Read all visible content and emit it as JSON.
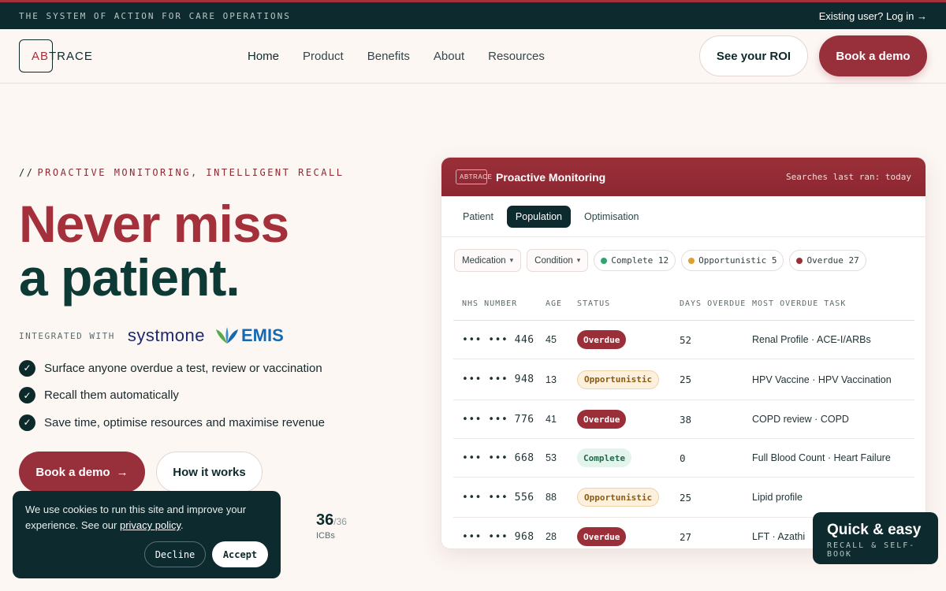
{
  "topbar": {
    "tagline": "THE SYSTEM OF ACTION FOR CARE OPERATIONS",
    "login": "Existing user? Log in →"
  },
  "brand": {
    "logo_ab": "AB",
    "logo_rest": "TRACE"
  },
  "nav": {
    "links": [
      "Home",
      "Product",
      "Benefits",
      "About",
      "Resources"
    ],
    "roi_label": "See your ROI",
    "demo_label": "Book a demo"
  },
  "hero": {
    "eyebrow_prefix": "//",
    "eyebrow": "PROACTIVE MONITORING, INTELLIGENT RECALL",
    "headline_line1": "Never miss",
    "headline_line2": "a patient.",
    "integrated_label": "INTEGRATED WITH",
    "partner1": "systmone",
    "partner2": "EMIS",
    "checks": [
      "Surface anyone overdue a test, review or vaccination",
      "Recall them automatically",
      "Save time, optimise resources and maximise revenue"
    ],
    "cta_primary": "Book a demo",
    "cta_secondary": "How it works",
    "stat_value": "36",
    "stat_total": "/36",
    "stat_label": "ICBs"
  },
  "cookie": {
    "message": "We use cookies to run this site and improve your experience. See our",
    "link": "privacy policy",
    "decline": "Decline",
    "accept": "Accept"
  },
  "panel": {
    "mini_logo": "ABTRACE",
    "title": "Proactive Monitoring",
    "meta": "Searches last ran: today",
    "tabs": [
      "Patient",
      "Population",
      "Optimisation"
    ],
    "active_tab": "Population",
    "filter_medication": "Medication",
    "filter_condition": "Condition",
    "pills": [
      {
        "label": "Complete 12",
        "color": "#2fa56e"
      },
      {
        "label": "Opportunistic 5",
        "color": "#e0a030"
      },
      {
        "label": "Overdue 27",
        "color": "#9a2f39"
      }
    ],
    "columns": [
      "NHS NUMBER",
      "AGE",
      "STATUS",
      "DAYS OVERDUE",
      "MOST OVERDUE TASK"
    ],
    "rows": [
      {
        "nhs": "••• ••• 446",
        "age": "45",
        "status": "Overdue",
        "days": "52",
        "task": "Renal Profile · ACE-I/ARBs"
      },
      {
        "nhs": "••• ••• 948",
        "age": "13",
        "status": "Opportunistic",
        "days": "25",
        "task": "HPV Vaccine · HPV Vaccination"
      },
      {
        "nhs": "••• ••• 776",
        "age": "41",
        "status": "Overdue",
        "days": "38",
        "task": "COPD review · COPD"
      },
      {
        "nhs": "••• ••• 668",
        "age": "53",
        "status": "Complete",
        "days": "0",
        "task": "Full Blood Count · Heart Failure"
      },
      {
        "nhs": "••• ••• 556",
        "age": "88",
        "status": "Opportunistic",
        "days": "25",
        "task": "Lipid profile"
      },
      {
        "nhs": "••• ••• 968",
        "age": "28",
        "status": "Overdue",
        "days": "27",
        "task": "LFT · Azathi"
      }
    ]
  },
  "quick": {
    "title": "Quick & easy",
    "subtitle": "RECALL & SELF-BOOK"
  },
  "colors": {
    "accent": "#97303a",
    "dark": "#0d2a2e"
  }
}
